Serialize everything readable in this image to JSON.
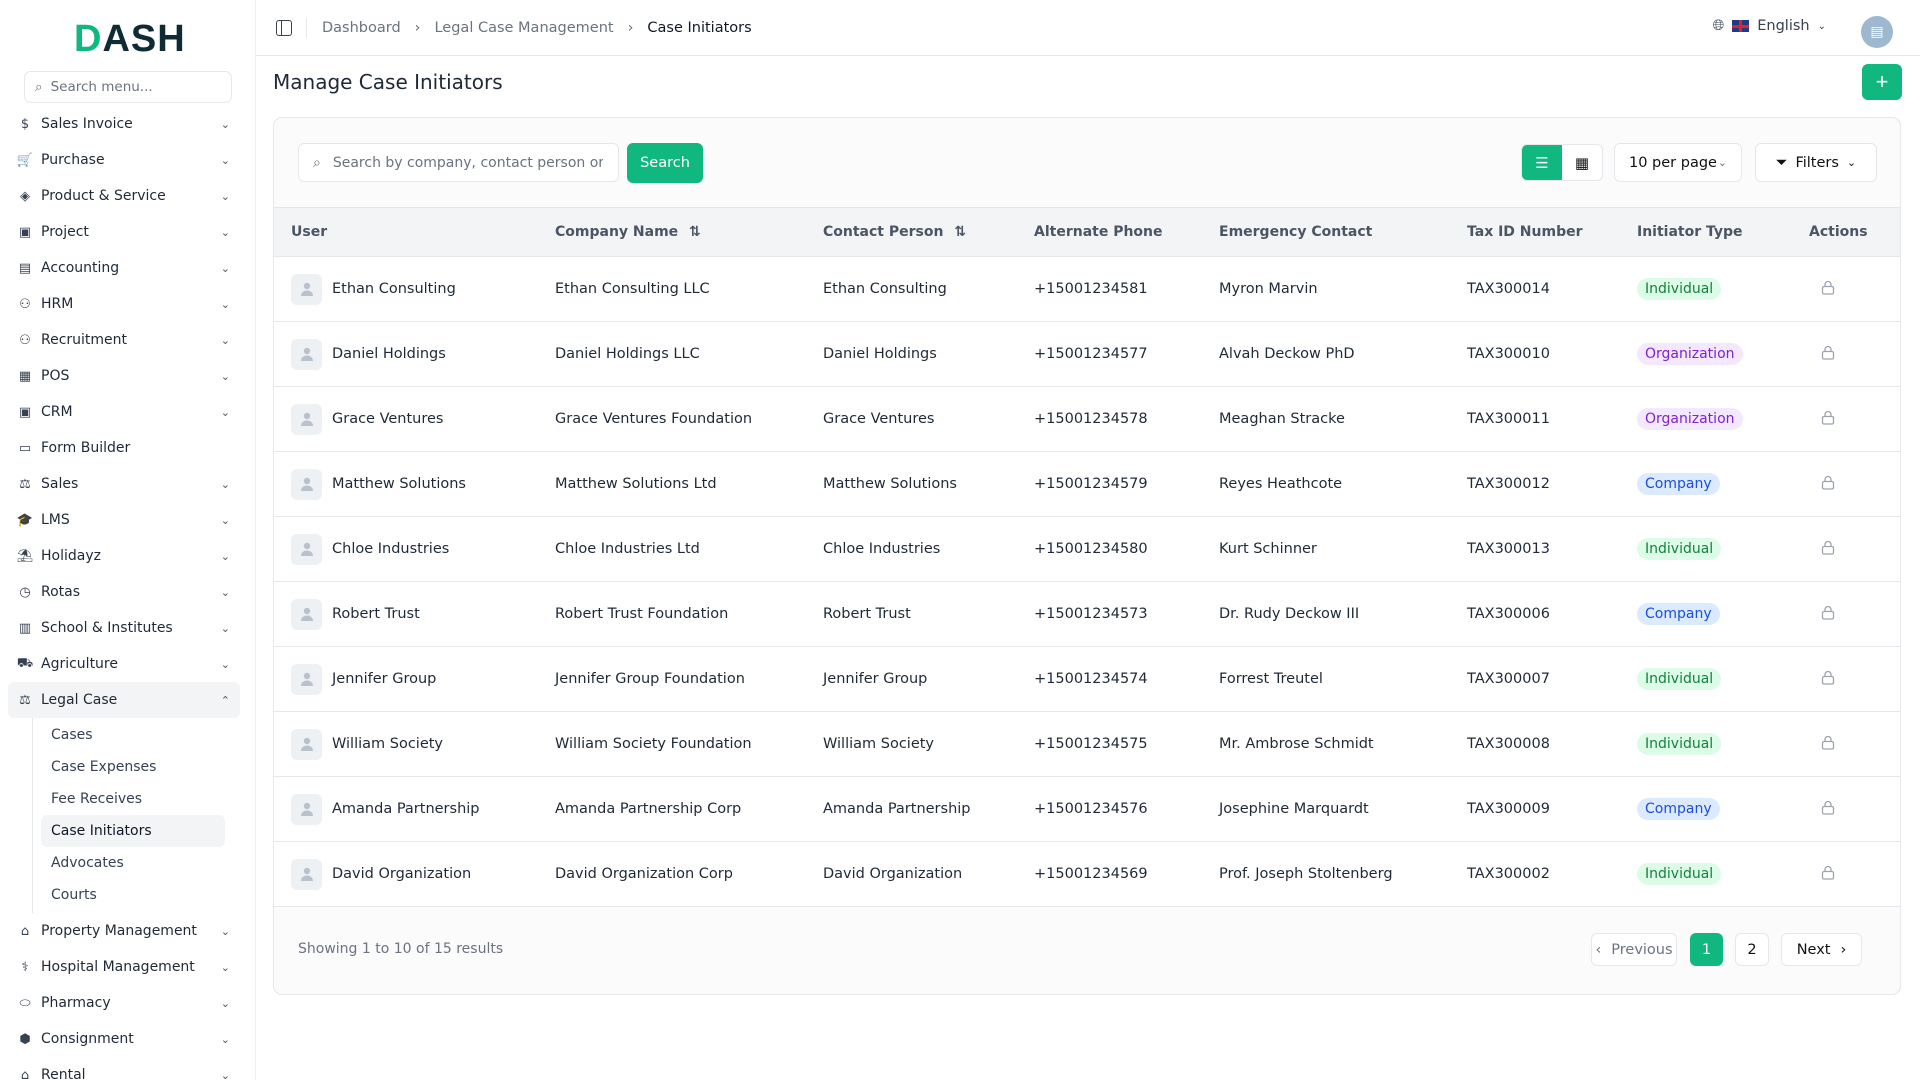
{
  "brand": {
    "logo": "DASH"
  },
  "sidebar": {
    "search_placeholder": "Search menu...",
    "items": [
      {
        "label": "Sales Invoice",
        "icon": "invoice-icon",
        "glyph": "$"
      },
      {
        "label": "Purchase",
        "icon": "cart-icon",
        "glyph": "🛒"
      },
      {
        "label": "Product & Service",
        "icon": "layers-icon",
        "glyph": "◈"
      },
      {
        "label": "Project",
        "icon": "folder-icon",
        "glyph": "▣"
      },
      {
        "label": "Accounting",
        "icon": "calculator-icon",
        "glyph": "▤"
      },
      {
        "label": "HRM",
        "icon": "users-icon",
        "glyph": "⚇"
      },
      {
        "label": "Recruitment",
        "icon": "user-plus-icon",
        "glyph": "⚇"
      },
      {
        "label": "POS",
        "icon": "register-icon",
        "glyph": "▦"
      },
      {
        "label": "CRM",
        "icon": "contact-icon",
        "glyph": "▣"
      },
      {
        "label": "Form Builder",
        "icon": "form-icon",
        "glyph": "▭",
        "nochev": true
      },
      {
        "label": "Sales",
        "icon": "sales-icon",
        "glyph": "⚖"
      },
      {
        "label": "LMS",
        "icon": "graduation-icon",
        "glyph": "🎓"
      },
      {
        "label": "Holidayz",
        "icon": "holiday-icon",
        "glyph": "⛱"
      },
      {
        "label": "Rotas",
        "icon": "rota-icon",
        "glyph": "◷"
      },
      {
        "label": "School & Institutes",
        "icon": "school-icon",
        "glyph": "▥"
      },
      {
        "label": "Agriculture",
        "icon": "tractor-icon",
        "glyph": "⛟"
      },
      {
        "label": "Legal Case",
        "icon": "scale-icon",
        "glyph": "⚖",
        "open": true,
        "children": [
          "Cases",
          "Case Expenses",
          "Fee Receives",
          "Case Initiators",
          "Advocates",
          "Courts"
        ],
        "active_child": 3
      },
      {
        "label": "Property Management",
        "icon": "property-icon",
        "glyph": "⌂"
      },
      {
        "label": "Hospital Management",
        "icon": "stethoscope-icon",
        "glyph": "⚕"
      },
      {
        "label": "Pharmacy",
        "icon": "pill-icon",
        "glyph": "⬭"
      },
      {
        "label": "Consignment",
        "icon": "box-icon",
        "glyph": "⬢"
      },
      {
        "label": "Rental",
        "icon": "home-icon",
        "glyph": "⌂"
      }
    ]
  },
  "topbar": {
    "breadcrumbs": [
      "Dashboard",
      "Legal Case Management",
      "Case Initiators"
    ],
    "language": "English"
  },
  "page": {
    "title": "Manage Case Initiators"
  },
  "toolbar": {
    "search_placeholder": "Search by company, contact person or user",
    "search_label": "Search",
    "per_page": "10 per page",
    "filters_label": "Filters"
  },
  "table": {
    "columns": [
      "User",
      "Company Name",
      "Contact Person",
      "Alternate Phone",
      "Emergency Contact",
      "Tax ID Number",
      "Initiator Type",
      "Actions"
    ],
    "rows": [
      [
        "Ethan Consulting",
        "Ethan Consulting LLC",
        "Ethan Consulting",
        "+15001234581",
        "Myron Marvin",
        "TAX300014",
        "Individual"
      ],
      [
        "Daniel Holdings",
        "Daniel Holdings LLC",
        "Daniel Holdings",
        "+15001234577",
        "Alvah Deckow PhD",
        "TAX300010",
        "Organization"
      ],
      [
        "Grace Ventures",
        "Grace Ventures Foundation",
        "Grace Ventures",
        "+15001234578",
        "Meaghan Stracke",
        "TAX300011",
        "Organization"
      ],
      [
        "Matthew Solutions",
        "Matthew Solutions Ltd",
        "Matthew Solutions",
        "+15001234579",
        "Reyes Heathcote",
        "TAX300012",
        "Company"
      ],
      [
        "Chloe Industries",
        "Chloe Industries Ltd",
        "Chloe Industries",
        "+15001234580",
        "Kurt Schinner",
        "TAX300013",
        "Individual"
      ],
      [
        "Robert Trust",
        "Robert Trust Foundation",
        "Robert Trust",
        "+15001234573",
        "Dr. Rudy Deckow III",
        "TAX300006",
        "Company"
      ],
      [
        "Jennifer Group",
        "Jennifer Group Foundation",
        "Jennifer Group",
        "+15001234574",
        "Forrest Treutel",
        "TAX300007",
        "Individual"
      ],
      [
        "William Society",
        "William Society Foundation",
        "William Society",
        "+15001234575",
        "Mr. Ambrose Schmidt",
        "TAX300008",
        "Individual"
      ],
      [
        "Amanda Partnership",
        "Amanda Partnership Corp",
        "Amanda Partnership",
        "+15001234576",
        "Josephine Marquardt",
        "TAX300009",
        "Company"
      ],
      [
        "David Organization",
        "David Organization Corp",
        "David Organization",
        "+15001234569",
        "Prof. Joseph Stoltenberg",
        "TAX300002",
        "Individual"
      ]
    ]
  },
  "footer": {
    "info": "Showing 1 to 10 of 15 results",
    "previous": "Previous",
    "next": "Next",
    "pages": [
      "1",
      "2"
    ],
    "current_page": "1"
  },
  "colors": {
    "accent": "#10b77f"
  }
}
